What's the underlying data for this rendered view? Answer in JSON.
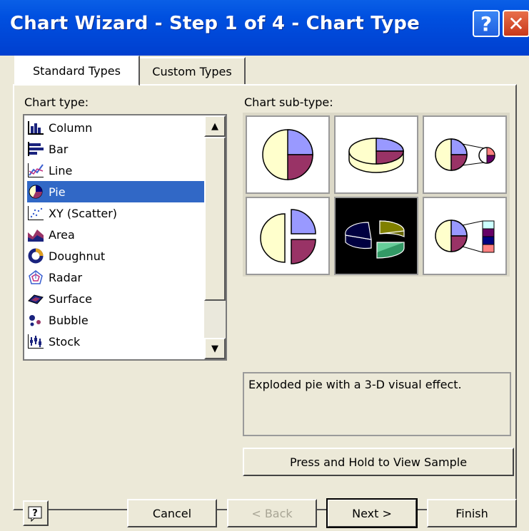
{
  "window": {
    "title": "Chart Wizard - Step 1 of 4 - Chart Type",
    "help_glyph": "?",
    "close_glyph": "✕"
  },
  "tabs": [
    {
      "label": "Standard Types",
      "active": true
    },
    {
      "label": "Custom Types",
      "active": false
    }
  ],
  "chart_type": {
    "label": "Chart type:",
    "items": [
      {
        "label": "Column",
        "icon": "column-chart-icon"
      },
      {
        "label": "Bar",
        "icon": "bar-chart-icon"
      },
      {
        "label": "Line",
        "icon": "line-chart-icon"
      },
      {
        "label": "Pie",
        "icon": "pie-chart-icon",
        "selected": true
      },
      {
        "label": "XY (Scatter)",
        "icon": "scatter-chart-icon"
      },
      {
        "label": "Area",
        "icon": "area-chart-icon"
      },
      {
        "label": "Doughnut",
        "icon": "doughnut-chart-icon"
      },
      {
        "label": "Radar",
        "icon": "radar-chart-icon"
      },
      {
        "label": "Surface",
        "icon": "surface-chart-icon"
      },
      {
        "label": "Bubble",
        "icon": "bubble-chart-icon"
      },
      {
        "label": "Stock",
        "icon": "stock-chart-icon"
      }
    ],
    "scroll_up": "▲",
    "scroll_down": "▼"
  },
  "sub_type": {
    "label": "Chart sub-type:",
    "items": [
      "pie",
      "3d-pie",
      "pie-of-pie",
      "exploded-pie",
      "exploded-3d-pie",
      "bar-of-pie"
    ],
    "selected_index": 4,
    "description": "Exploded pie with a 3-D visual effect.",
    "sample_button": "Press and Hold to View Sample"
  },
  "footer": {
    "cancel": "Cancel",
    "back": "< Back",
    "next": "Next >",
    "finish": "Finish"
  },
  "colors": {
    "pie_lavender": "#9999ff",
    "pie_maroon": "#993366",
    "pie_cream": "#ffffcc",
    "selection": "#3168c6"
  }
}
